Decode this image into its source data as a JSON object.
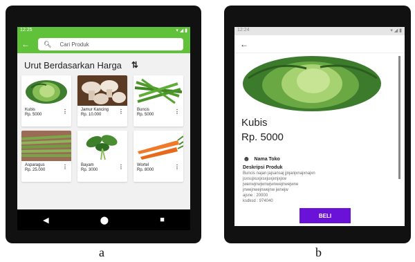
{
  "phone_a": {
    "status_time": "12:25",
    "status_icons": "▾ ◢ ▮",
    "search_placeholder": "Cari Produk",
    "sort_title": "Urut Berdasarkan Harga",
    "products": [
      {
        "name": "Kubis",
        "price": "Rp. 5000",
        "image": "cabbage"
      },
      {
        "name": "Jamur Kancing",
        "price": "Rp. 10.000",
        "image": "mushroom"
      },
      {
        "name": "Buncis",
        "price": "Rp. 5000",
        "image": "green-bean"
      },
      {
        "name": "Asparagus",
        "price": "Rp. 25.000",
        "image": "asparagus"
      },
      {
        "name": "Bayam",
        "price": "Rp. 3000",
        "image": "spinach"
      },
      {
        "name": "Wortel",
        "price": "Rp. 8000",
        "image": "carrot"
      }
    ]
  },
  "phone_b": {
    "status_time": "12:24",
    "product_name": "Kubis",
    "product_price": "Rp. 5000",
    "shop_name": "Nama Toko",
    "desc_title": "Deskripsi Produk",
    "desc_lines": [
      "Buncis najan jajsansaj jjnjanjxnajxnajxn",
      "jsxsujxuxjxsxjuxjxnjxjxw",
      "jwenwjnwjwnwjwnwejnwejwne",
      "jnwejnwejnwejnw jwnejw",
      "ajsne : 20000",
      "ksdksd : 974040"
    ],
    "buy_label": "BELI"
  },
  "captions": {
    "a": "a",
    "b": "b"
  },
  "colors": {
    "accent_green": "#5fc238",
    "buy_purple": "#6a12d8"
  }
}
